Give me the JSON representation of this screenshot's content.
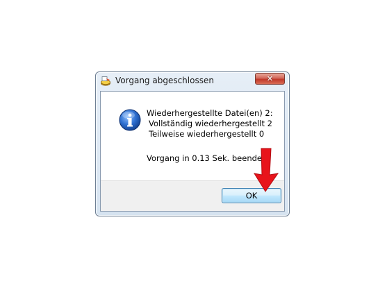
{
  "window": {
    "title": "Vorgang abgeschlossen",
    "close_glyph": "✕"
  },
  "message": {
    "line1": "Wiederhergestellte Datei(en) 2:",
    "line2": "Vollständig wiederhergestellt 2",
    "line3": "Teilweise wiederhergestellt 0",
    "duration": "Vorgang in 0.13 Sek. beendet."
  },
  "buttons": {
    "ok_label": "OK"
  },
  "icons": {
    "app": "recovery-app-icon",
    "message": "information-icon",
    "annotation": "red-arrow-icon"
  },
  "colors": {
    "annotation_arrow": "#e8141b",
    "info_icon": "#1f5fbf",
    "close_button": "#c0392b"
  }
}
